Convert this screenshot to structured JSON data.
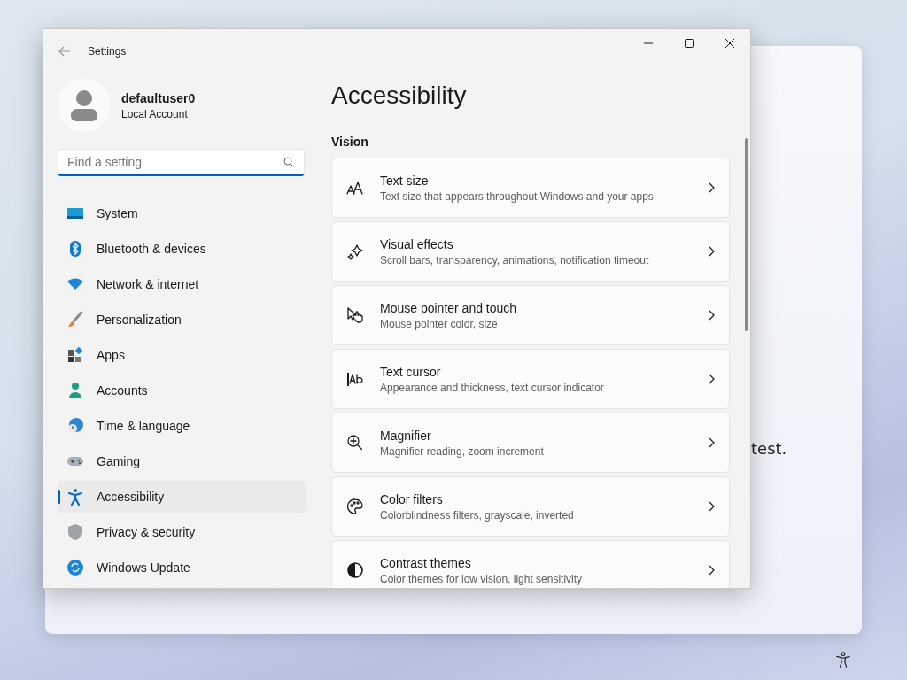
{
  "background_window": {
    "text": "test."
  },
  "window": {
    "title": "Settings"
  },
  "account": {
    "name": "defaultuser0",
    "type": "Local Account"
  },
  "search": {
    "placeholder": "Find a setting"
  },
  "sidebar": {
    "items": [
      {
        "label": "System",
        "selected": false
      },
      {
        "label": "Bluetooth & devices",
        "selected": false
      },
      {
        "label": "Network & internet",
        "selected": false
      },
      {
        "label": "Personalization",
        "selected": false
      },
      {
        "label": "Apps",
        "selected": false
      },
      {
        "label": "Accounts",
        "selected": false
      },
      {
        "label": "Time & language",
        "selected": false
      },
      {
        "label": "Gaming",
        "selected": false
      },
      {
        "label": "Accessibility",
        "selected": true
      },
      {
        "label": "Privacy & security",
        "selected": false
      },
      {
        "label": "Windows Update",
        "selected": false
      }
    ]
  },
  "page": {
    "title": "Accessibility",
    "section": "Vision",
    "cards": [
      {
        "title": "Text size",
        "subtitle": "Text size that appears throughout Windows and your apps"
      },
      {
        "title": "Visual effects",
        "subtitle": "Scroll bars, transparency, animations, notification timeout"
      },
      {
        "title": "Mouse pointer and touch",
        "subtitle": "Mouse pointer color, size"
      },
      {
        "title": "Text cursor",
        "subtitle": "Appearance and thickness, text cursor indicator"
      },
      {
        "title": "Magnifier",
        "subtitle": "Magnifier reading, zoom increment"
      },
      {
        "title": "Color filters",
        "subtitle": "Colorblindness filters, grayscale, inverted"
      },
      {
        "title": "Contrast themes",
        "subtitle": "Color themes for low vision, light sensitivity"
      }
    ]
  }
}
